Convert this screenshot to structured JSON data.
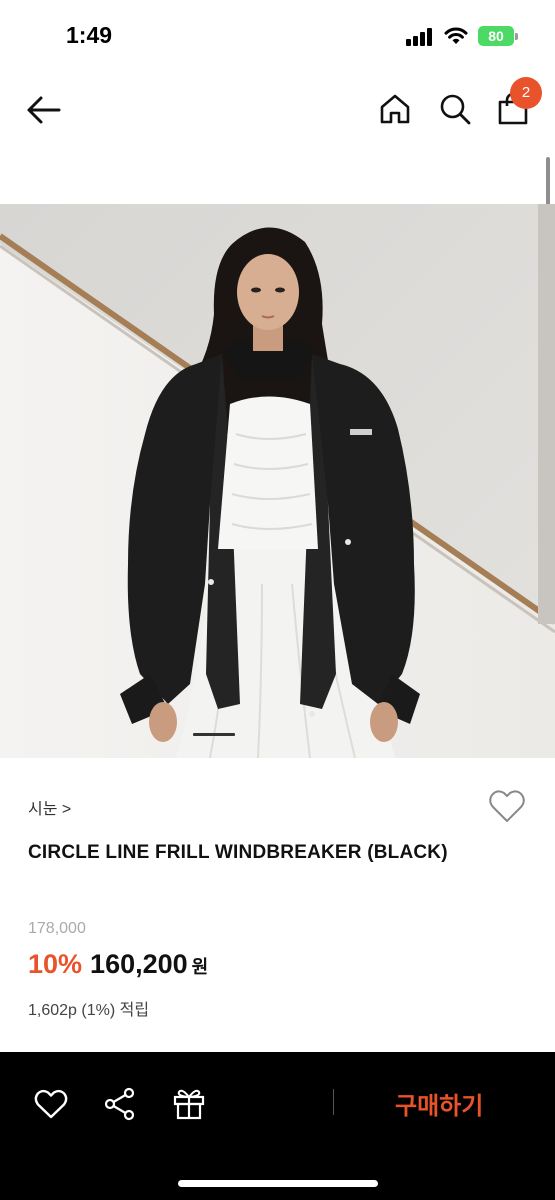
{
  "status_bar": {
    "time": "1:49",
    "battery": "80",
    "battery_color": "#4cd964"
  },
  "header": {
    "back_icon": "arrow-left-icon",
    "home_icon": "home-icon",
    "search_icon": "search-icon",
    "cart_icon": "shopping-bag-icon",
    "cart_count": "2"
  },
  "product": {
    "image_alt": "model wearing black windbreaker over white dress",
    "brand": "시눈 >",
    "name": "CIRCLE LINE FRILL WINDBREAKER (BLACK)",
    "original_price": "178,000",
    "discount": "10%",
    "sale_price": "160,200",
    "currency": "원",
    "points": "1,602p (1%) 적립"
  },
  "bottom_bar": {
    "like_icon": "heart-icon",
    "share_icon": "share-icon",
    "gift_icon": "gift-icon",
    "buy_label": "구매하기"
  },
  "colors": {
    "accent": "#e8532b",
    "bottom_bar_bg": "#000000"
  }
}
